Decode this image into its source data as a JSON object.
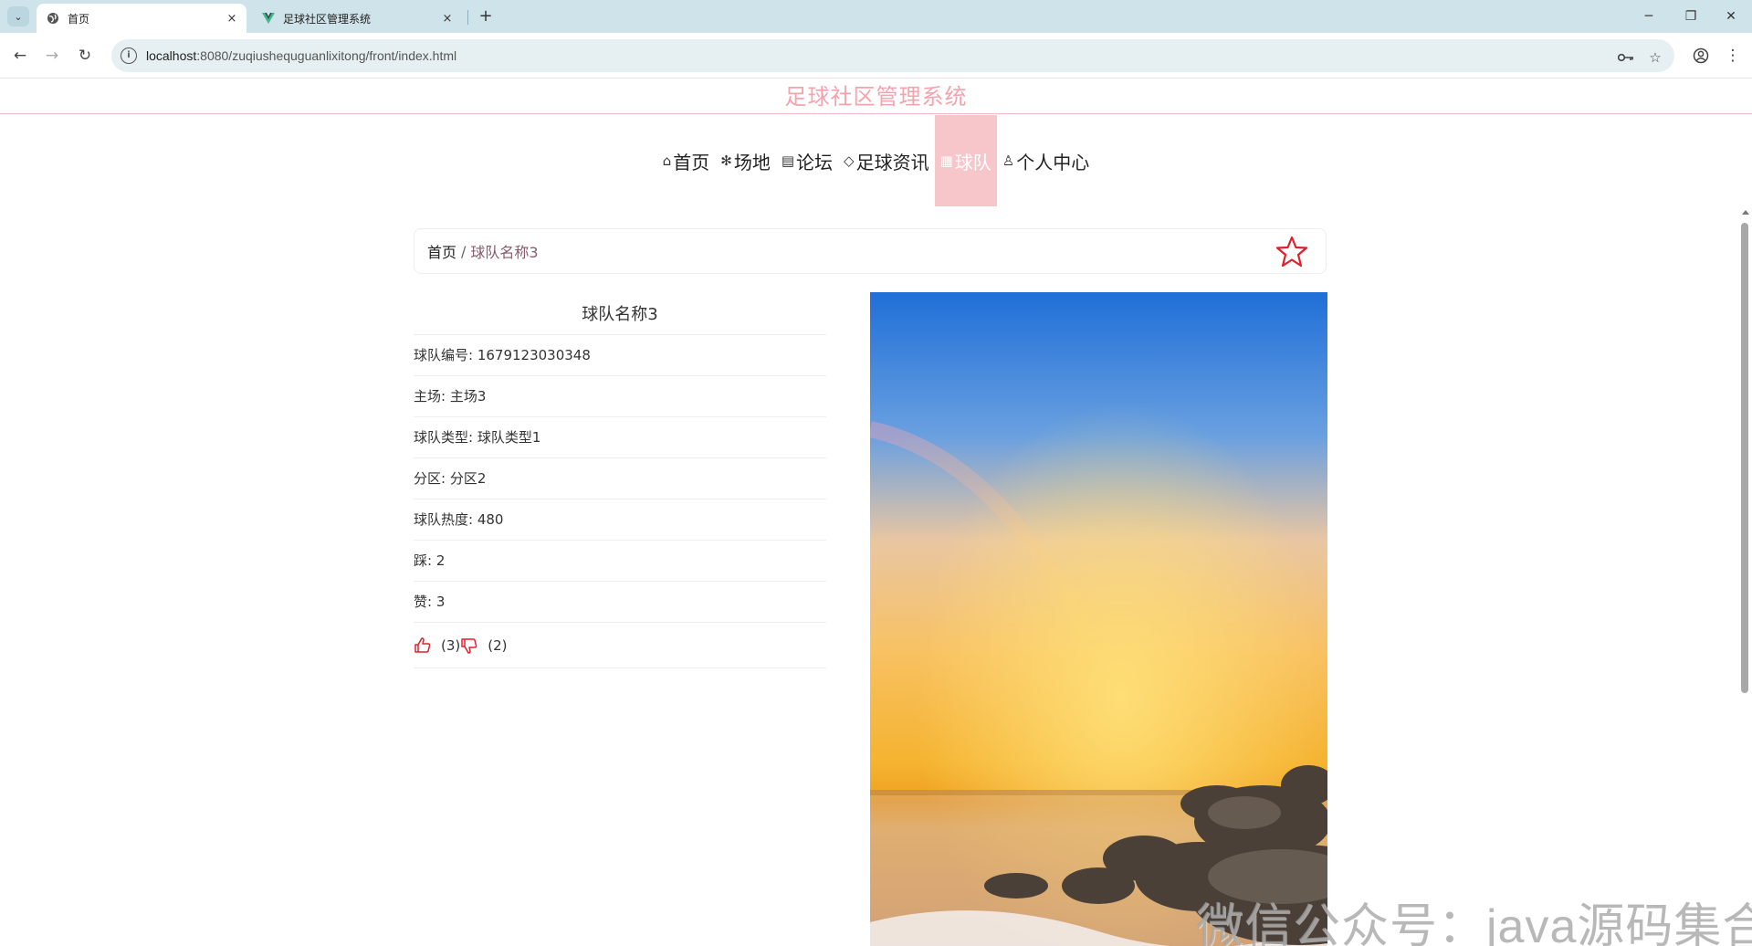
{
  "browser": {
    "tabs": [
      {
        "title": "首页",
        "icon": "globe-icon",
        "active": true
      },
      {
        "title": "足球社区管理系统",
        "icon": "vue-logo-icon",
        "active": false
      }
    ],
    "close_glyph": "×",
    "new_tab_glyph": "+",
    "url_host": "localhost",
    "url_rest": ":8080/zuqiushequguanlixitong/front/index.html",
    "window_controls": [
      "─",
      "❐",
      "✕"
    ]
  },
  "site": {
    "title": "足球社区管理系统",
    "accent_color": "#f5a3ad",
    "nav": [
      {
        "label": "首页",
        "icon": "⌂",
        "active": false
      },
      {
        "label": "场地",
        "icon": "✻",
        "active": false
      },
      {
        "label": "论坛",
        "icon": "▤",
        "active": false
      },
      {
        "label": "足球资讯",
        "icon": "◇",
        "active": false
      },
      {
        "label": "球队",
        "icon": "▦",
        "active": true
      },
      {
        "label": "个人中心",
        "icon": "♙",
        "active": false
      }
    ]
  },
  "breadcrumb": {
    "home": "首页",
    "separator": "/",
    "current": "球队名称3"
  },
  "detail": {
    "title": "球队名称3",
    "fields": [
      "球队编号: 1679123030348",
      "主场: 主场3",
      "球队类型: 球队类型1",
      "分区: 分区2",
      "球队热度: 480",
      "踩: 2",
      "赞: 3"
    ],
    "like_count": "(3)",
    "dislike_count": "(2)"
  },
  "watermark": "微信公众号：java源码集合"
}
